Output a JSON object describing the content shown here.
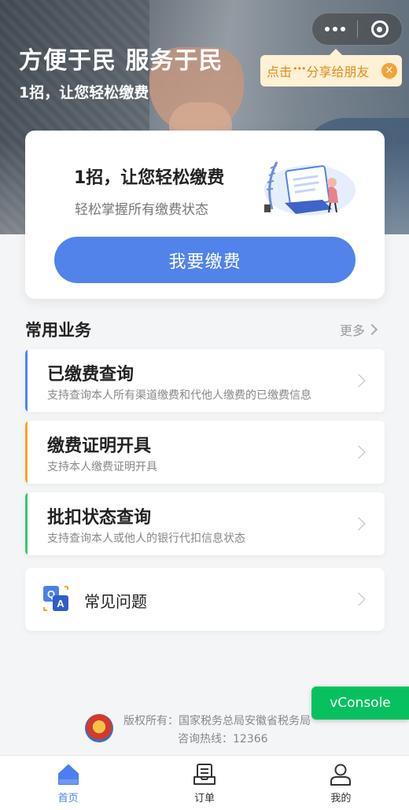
{
  "hero": {
    "title": "方便于民 服务于民",
    "subtitle": "1招，让您轻松缴费"
  },
  "tip": {
    "prefix": "点击",
    "dots": "•••",
    "suffix": "分享给朋友",
    "close_label": "×"
  },
  "card": {
    "title": "1招，让您轻松缴费",
    "subtitle": "轻松掌握所有缴费状态",
    "button_label": "我要缴费"
  },
  "section": {
    "title": "常用业务",
    "more_label": "更多"
  },
  "services": [
    {
      "title": "已缴费查询",
      "desc": "支持查询本人所有渠道缴费和代他人缴费的已缴费信息",
      "accent": "#5283ea"
    },
    {
      "title": "缴费证明开具",
      "desc": "支持本人缴费证明开具",
      "accent": "#f5a623"
    },
    {
      "title": "批扣状态查询",
      "desc": "支持查询本人或他人的银行代扣信息状态",
      "accent": "#3ec46d"
    }
  ],
  "faq": {
    "label": "常见问题"
  },
  "vconsole": {
    "label": "vConsole"
  },
  "footer": {
    "copyright": "版权所有：国家税务总局安徽省税务局",
    "hotline": "咨询热线：12366"
  },
  "tabs": [
    {
      "label": "首页",
      "icon": "home-icon",
      "active": true
    },
    {
      "label": "订单",
      "icon": "order-icon",
      "active": false
    },
    {
      "label": "我的",
      "icon": "user-icon",
      "active": false
    }
  ],
  "colors": {
    "primary": "#5283ea",
    "tab_active": "#4b7ef0",
    "vconsole": "#07c160",
    "tip_text": "#e08a1a"
  }
}
